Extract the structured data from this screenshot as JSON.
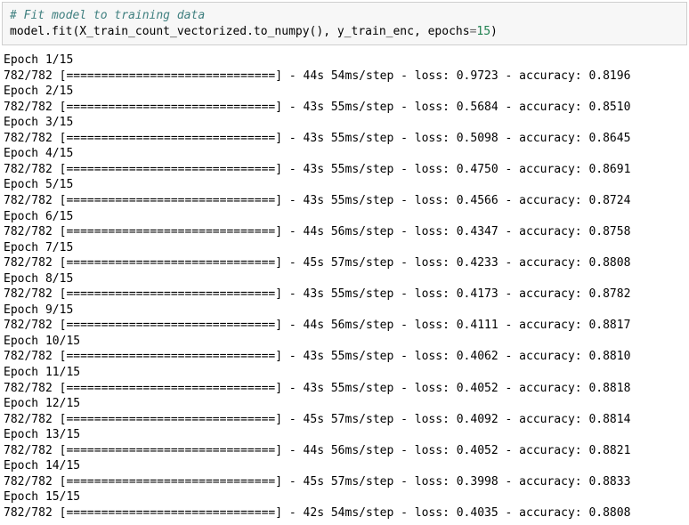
{
  "code": {
    "comment": "# Fit model to training data",
    "call_pre": "model.fit(X_train_count_vectorized.to_numpy(), y_train_enc, epochs",
    "assign": "=",
    "epochs_val": "15",
    "call_post": ")"
  },
  "progress_full": "[==============================]",
  "epochs": [
    {
      "label": "Epoch 1/15",
      "steps": "782/782",
      "time": "44s 54ms/step",
      "loss": "0.9723",
      "acc": "0.8196"
    },
    {
      "label": "Epoch 2/15",
      "steps": "782/782",
      "time": "43s 55ms/step",
      "loss": "0.5684",
      "acc": "0.8510"
    },
    {
      "label": "Epoch 3/15",
      "steps": "782/782",
      "time": "43s 55ms/step",
      "loss": "0.5098",
      "acc": "0.8645"
    },
    {
      "label": "Epoch 4/15",
      "steps": "782/782",
      "time": "43s 55ms/step",
      "loss": "0.4750",
      "acc": "0.8691"
    },
    {
      "label": "Epoch 5/15",
      "steps": "782/782",
      "time": "43s 55ms/step",
      "loss": "0.4566",
      "acc": "0.8724"
    },
    {
      "label": "Epoch 6/15",
      "steps": "782/782",
      "time": "44s 56ms/step",
      "loss": "0.4347",
      "acc": "0.8758"
    },
    {
      "label": "Epoch 7/15",
      "steps": "782/782",
      "time": "45s 57ms/step",
      "loss": "0.4233",
      "acc": "0.8808"
    },
    {
      "label": "Epoch 8/15",
      "steps": "782/782",
      "time": "43s 55ms/step",
      "loss": "0.4173",
      "acc": "0.8782"
    },
    {
      "label": "Epoch 9/15",
      "steps": "782/782",
      "time": "44s 56ms/step",
      "loss": "0.4111",
      "acc": "0.8817"
    },
    {
      "label": "Epoch 10/15",
      "steps": "782/782",
      "time": "43s 55ms/step",
      "loss": "0.4062",
      "acc": "0.8810"
    },
    {
      "label": "Epoch 11/15",
      "steps": "782/782",
      "time": "43s 55ms/step",
      "loss": "0.4052",
      "acc": "0.8818"
    },
    {
      "label": "Epoch 12/15",
      "steps": "782/782",
      "time": "45s 57ms/step",
      "loss": "0.4092",
      "acc": "0.8814"
    },
    {
      "label": "Epoch 13/15",
      "steps": "782/782",
      "time": "44s 56ms/step",
      "loss": "0.4052",
      "acc": "0.8821"
    },
    {
      "label": "Epoch 14/15",
      "steps": "782/782",
      "time": "45s 57ms/step",
      "loss": "0.3998",
      "acc": "0.8833"
    },
    {
      "label": "Epoch 15/15",
      "steps": "782/782",
      "time": "42s 54ms/step",
      "loss": "0.4035",
      "acc": "0.8808"
    }
  ]
}
